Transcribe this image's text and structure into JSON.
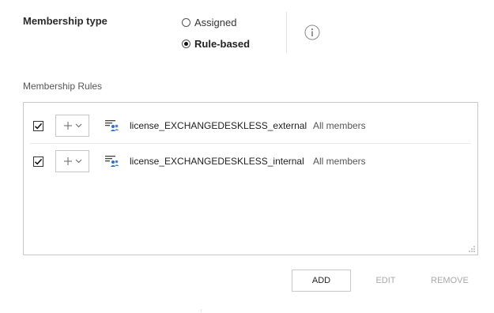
{
  "membership": {
    "label": "Membership type",
    "options": [
      {
        "label": "Assigned",
        "selected": false
      },
      {
        "label": "Rule-based",
        "selected": true
      }
    ],
    "info_icon": "info-icon"
  },
  "rules": {
    "section_label": "Membership Rules",
    "items": [
      {
        "checked": true,
        "operator_icon": "plus-icon",
        "icon": "group-icon",
        "name": "license_EXCHANGEDESKLESS_external",
        "scope": "All members"
      },
      {
        "checked": true,
        "operator_icon": "plus-icon",
        "icon": "group-icon",
        "name": "license_EXCHANGEDESKLESS_internal",
        "scope": "All members"
      }
    ]
  },
  "actions": {
    "add": "ADD",
    "edit": "EDIT",
    "remove": "REMOVE"
  },
  "colors": {
    "group_icon_blue": "#2f6fc4",
    "disabled_text": "#a9a9a9",
    "border": "#c8c8c8"
  }
}
